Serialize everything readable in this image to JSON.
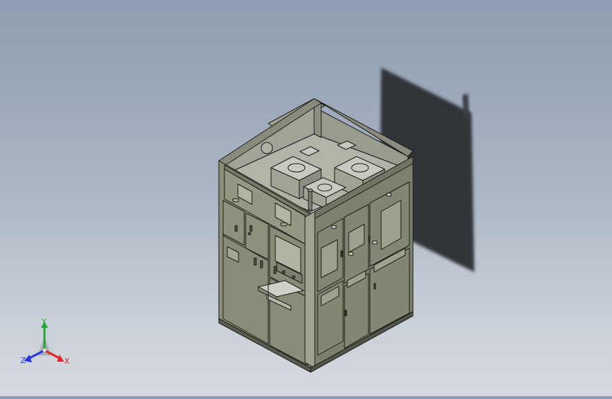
{
  "viewport": {
    "background_top": "#8e9db1",
    "background_bottom": "#d6dae0",
    "model": "switchgear-cabinet"
  },
  "triad": {
    "x_label": "X",
    "y_label": "Y",
    "z_label": "Z",
    "x_color": "#e0262a",
    "y_color": "#1faa2c",
    "z_color": "#2a36d8"
  },
  "colors": {
    "panel_face": "#8d8e79",
    "panel_side": "#7e7f6c",
    "interior": "#a6a79a",
    "edge": "#1b1c18",
    "shadow": "#2b2e33"
  }
}
